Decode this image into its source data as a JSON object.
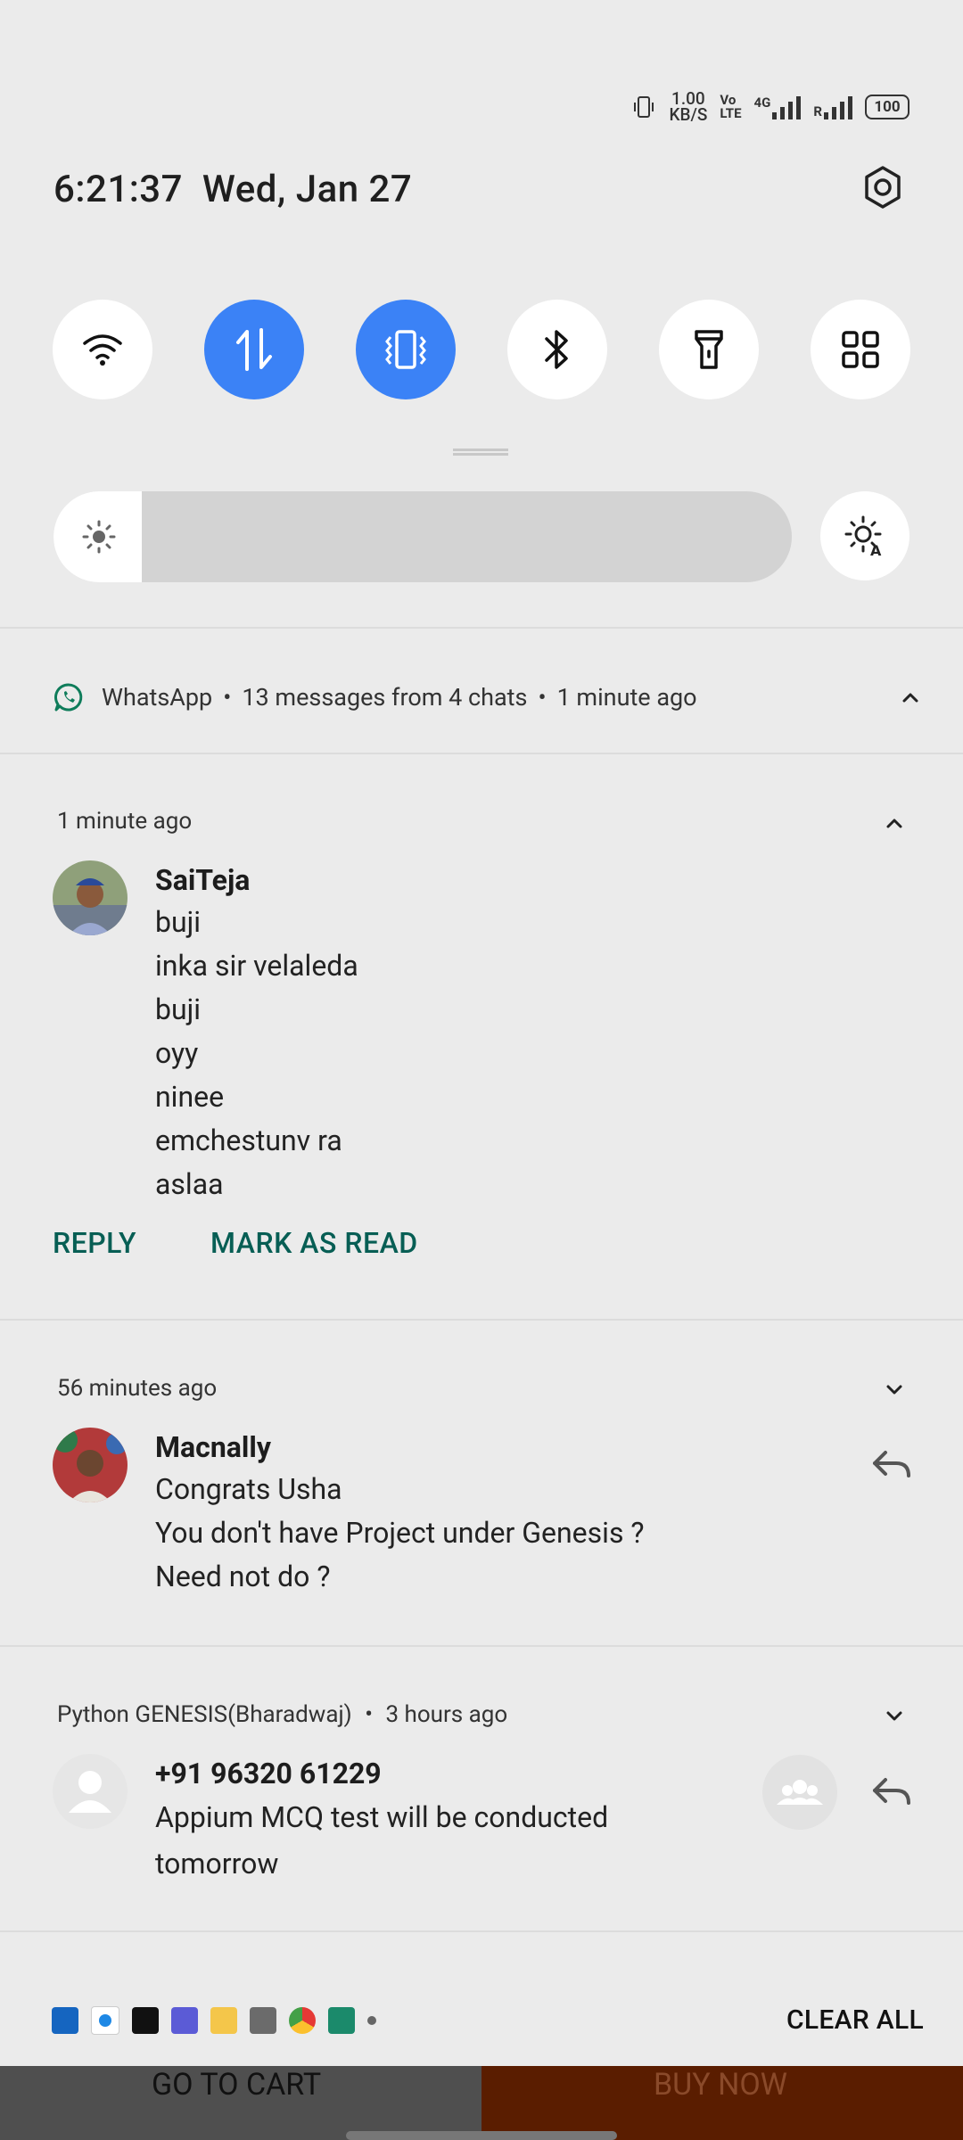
{
  "status_bar": {
    "speed_value": "1.00",
    "speed_unit": "KB/S",
    "volte_top": "Vo",
    "volte_bottom": "LTE",
    "network": "4G",
    "roaming": "R",
    "battery": "100"
  },
  "header": {
    "time": "6:21:37",
    "date": "Wed, Jan 27"
  },
  "quick_tiles": [
    {
      "icon": "wifi-icon",
      "active": false
    },
    {
      "icon": "mobile-data-icon",
      "active": true
    },
    {
      "icon": "vibrate-icon",
      "active": true
    },
    {
      "icon": "bluetooth-icon",
      "active": false
    },
    {
      "icon": "flashlight-icon",
      "active": false
    },
    {
      "icon": "apps-grid-icon",
      "active": false
    }
  ],
  "brightness": {
    "level": 0.12,
    "auto_icon": "auto-brightness-icon"
  },
  "whatsapp_group": {
    "app": "WhatsApp",
    "summary": "13 messages from 4 chats",
    "time": "1 minute ago"
  },
  "notifications": [
    {
      "time": "1 minute ago",
      "sender": "SaiTeja",
      "messages": [
        "buji",
        "inka sir velaleda",
        "buji",
        "oyy",
        "ninee",
        "emchestunv ra",
        "aslaa"
      ],
      "actions": [
        "REPLY",
        "MARK AS READ"
      ]
    },
    {
      "time": "56 minutes ago",
      "sender": "Macnally",
      "messages": [
        "Congrats Usha",
        "You don't have Project under Genesis ?",
        "Need not do ?"
      ]
    },
    {
      "group": "Python GENESIS(Bharadwaj)",
      "time": "3 hours ago",
      "sender": "+91 96320 61229",
      "messages": [
        "Appium MCQ test will be conducted",
        "tomorrow"
      ]
    }
  ],
  "bottom_bar": {
    "clear_all": "CLEAR ALL"
  },
  "behind_app": {
    "go_to_cart": "GO TO CART",
    "buy_now": "BUY NOW"
  },
  "colors": {
    "accent": "#3b82f6",
    "whatsapp_green": "#075e54",
    "panel_bg": "#ebebeb"
  }
}
